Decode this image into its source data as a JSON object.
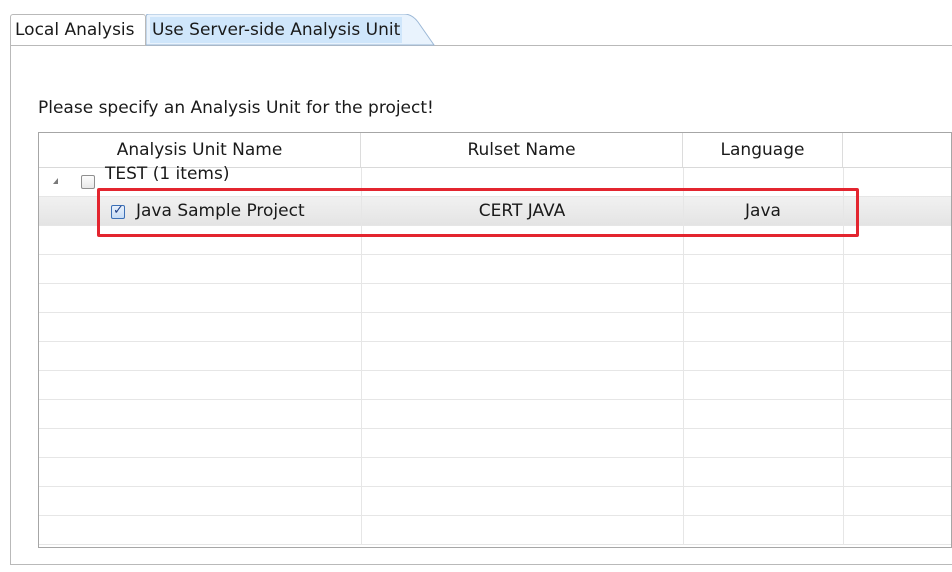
{
  "tabs": {
    "local_label": "Local Analysis",
    "server_label": "Use Server-side Analysis Unit"
  },
  "instruction": "Please specify an Analysis Unit for the project!",
  "table": {
    "columns": [
      "Analysis Unit Name",
      "Rulset Name",
      "Language"
    ],
    "group": {
      "label": "TEST (1 items)",
      "checked": false,
      "expanded": true
    },
    "rows": [
      {
        "name": "Java Sample Project",
        "ruleset": "CERT JAVA",
        "language": "Java",
        "checked": true,
        "selected": true
      }
    ]
  },
  "colors": {
    "highlight": "#e3252f",
    "active_tab_fill": "#cfe6fb"
  }
}
